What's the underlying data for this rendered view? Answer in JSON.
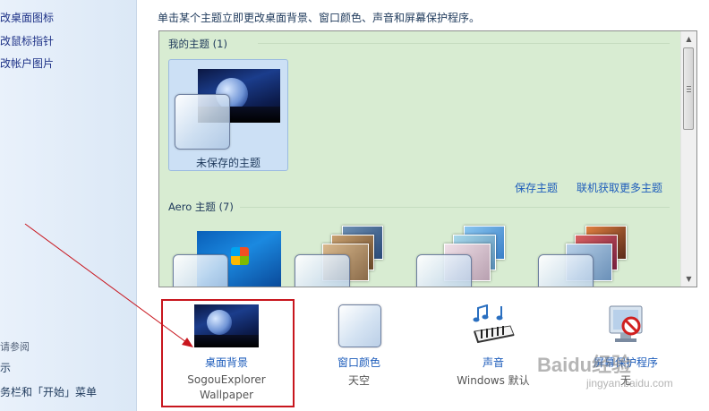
{
  "sidebar": {
    "links": [
      "改桌面图标",
      "改鼠标指针",
      "改帐户图片"
    ],
    "see_also_heading": "请参阅",
    "see_also_items": [
      "示",
      "务栏和「开始」菜单"
    ]
  },
  "main": {
    "intro": "单击某个主题立即更改桌面背景、窗口颜色、声音和屏幕保护程序。",
    "my_themes": {
      "title": "我的主题 (1)",
      "unsaved_label": "未保存的主题"
    },
    "actions": {
      "save_theme": "保存主题",
      "get_more": "联机获取更多主题"
    },
    "aero": {
      "title": "Aero 主题 (7)"
    },
    "settings": [
      {
        "link": "桌面背景",
        "value": "SogouExplorer Wallpaper",
        "icon": "wallpaper-thumbnail-icon"
      },
      {
        "link": "窗口颜色",
        "value": "天空",
        "icon": "window-color-icon"
      },
      {
        "link": "声音",
        "value": "Windows 默认",
        "icon": "sound-piano-icon"
      },
      {
        "link": "屏幕保护程序",
        "value": "无",
        "icon": "screensaver-icon"
      }
    ]
  },
  "watermark": {
    "logo": "Baidu经验",
    "url": "jingyan.baidu.com"
  },
  "colors": {
    "accent_link": "#1e5dbb",
    "highlight_box": "#c8161e",
    "theme_panel_bg": "#d8ecd2"
  }
}
